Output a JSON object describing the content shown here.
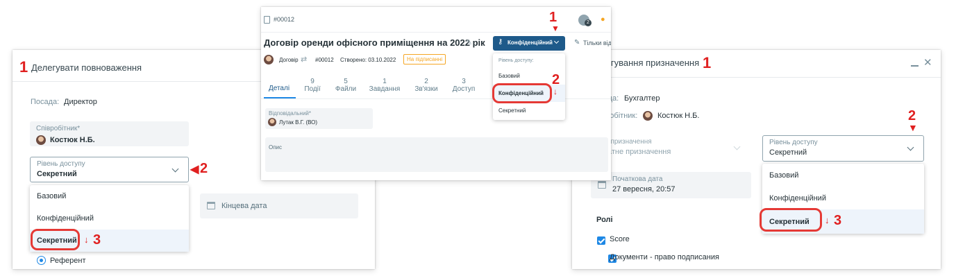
{
  "left": {
    "step_title": "1",
    "title": "Делегувати повноваження",
    "position_label": "Посада:",
    "position_value": "Директор",
    "employee_label": "Співробітник*",
    "employee_value": "Костюк Н.Б.",
    "access_label": "Рівень доступу",
    "access_value": "Секретний",
    "options": [
      "Базовий",
      "Конфіденційний",
      "Секретний"
    ],
    "end_date_placeholder": "Кінцева дата",
    "radio_label": "Референт",
    "step_dropdown": "2",
    "step_selected": "3"
  },
  "middle": {
    "doc_number": "#00012",
    "title": "Договір оренди офісного приміщення на 2022 рік",
    "access_button": "Конфіденційний",
    "readonly_label": "Тільки від",
    "notif_count": "2",
    "meta_type": "Договір",
    "meta_number": "#00012",
    "meta_created": "Створено: 03.10.2022",
    "meta_status": "На підписанні",
    "tabs": [
      {
        "count": "",
        "label": "Деталі"
      },
      {
        "count": "9",
        "label": "Події"
      },
      {
        "count": "5",
        "label": "Файли"
      },
      {
        "count": "1",
        "label": "Завдання"
      },
      {
        "count": "2",
        "label": "Зв'язки"
      },
      {
        "count": "3",
        "label": "Доступ"
      }
    ],
    "responsible_label": "Відповідальний*",
    "responsible_value": "Лутак В.Г. (ВО)",
    "description_label": "Опис",
    "menu_header": "Рівень доступу:",
    "options": [
      "Базовий",
      "Конфіденційний",
      "Секретний"
    ],
    "step_button": "1",
    "step_option": "2"
  },
  "right": {
    "step_title": "1",
    "title": "Редагування призначення",
    "position_label": "Посада:",
    "position_value": "Бухгалтер",
    "employee_label": "Співробітник:",
    "employee_value": "Костюк Н.Б.",
    "type_label": "Тип призначення",
    "type_value": "Штатне призначення",
    "access_label": "Рівень доступу",
    "access_value": "Секретний",
    "start_label": "Початкова дата",
    "start_value": "27 вересня, 20:57",
    "roles_label": "Ролі",
    "roles": [
      "Score",
      "Документи - право подписания"
    ],
    "options": [
      "Базовий",
      "Конфіденційний",
      "Секретний"
    ],
    "step_dropdown": "2",
    "step_selected": "3"
  },
  "colors": {
    "accent": "#1e5a8a",
    "annotation_red": "#e53935",
    "selected_bg": "#eef4fb",
    "status_orange": "#f5a623"
  }
}
